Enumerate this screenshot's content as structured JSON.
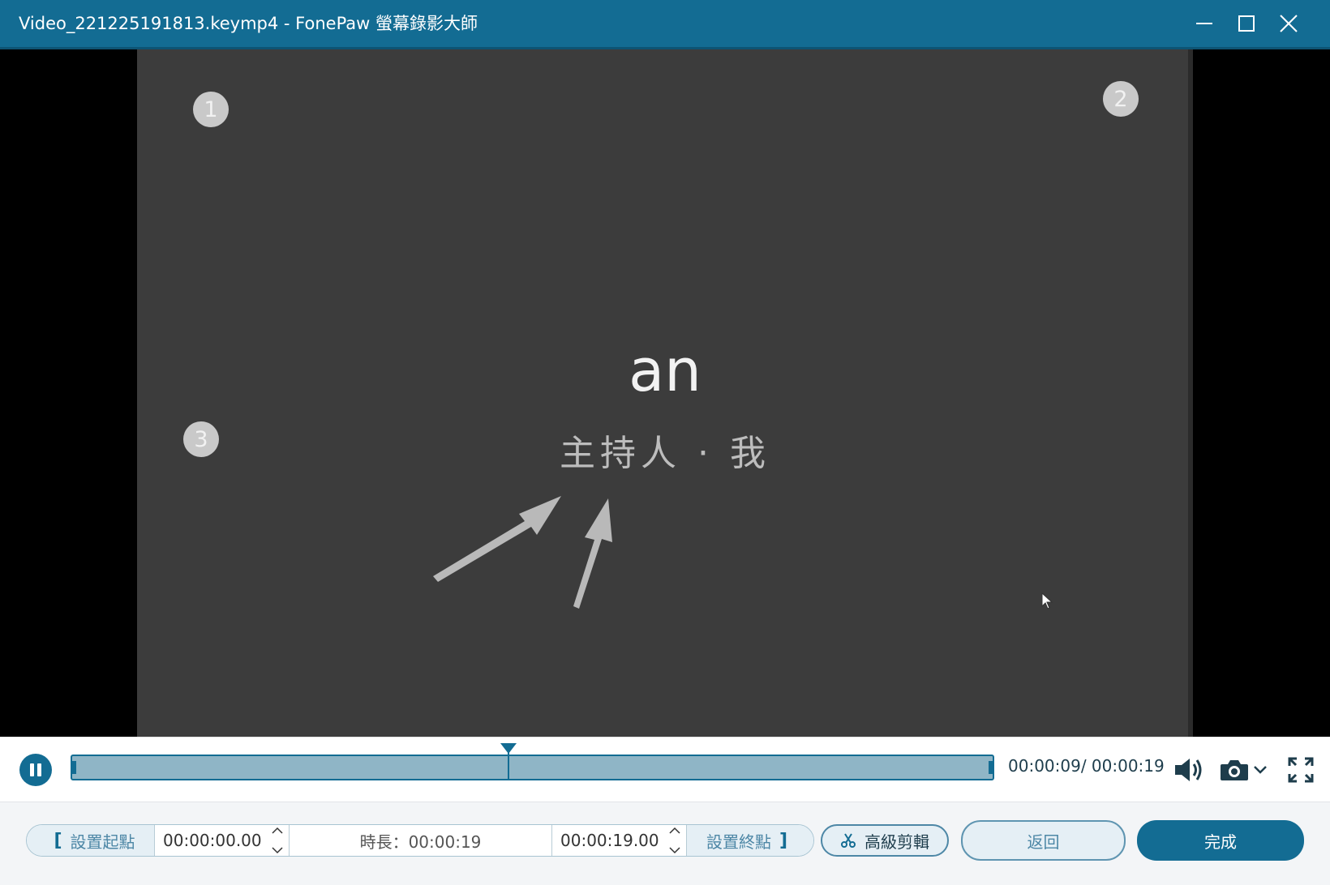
{
  "window": {
    "title": "Video_221225191813.keymp4  -  FonePaw 螢幕錄影大師",
    "controls": [
      "minimize-icon",
      "maximize-icon",
      "close-icon"
    ]
  },
  "video": {
    "markers": [
      "1",
      "2",
      "3"
    ],
    "title": "an",
    "subtitle": "主持人 · 我"
  },
  "player": {
    "state_icon": "pause-icon",
    "progress": 0.474,
    "timecode": "00:00:09/ 00:00:19",
    "icons": [
      "volume-icon",
      "camera-icon",
      "chevron-down-icon",
      "fullscreen-icon"
    ]
  },
  "trim": {
    "set_start_label": "設置起點",
    "start_time": "00:00:00.00",
    "duration_label": "時長：00:00:19",
    "end_time": "00:00:19.00",
    "set_end_label": "設置終點",
    "advanced_label": "高級剪輯",
    "back_label": "返回",
    "done_label": "完成"
  },
  "colors": {
    "accent": "#136c93",
    "timeline_fill": "#8fb5c6",
    "light_button": "#e5eff5"
  }
}
